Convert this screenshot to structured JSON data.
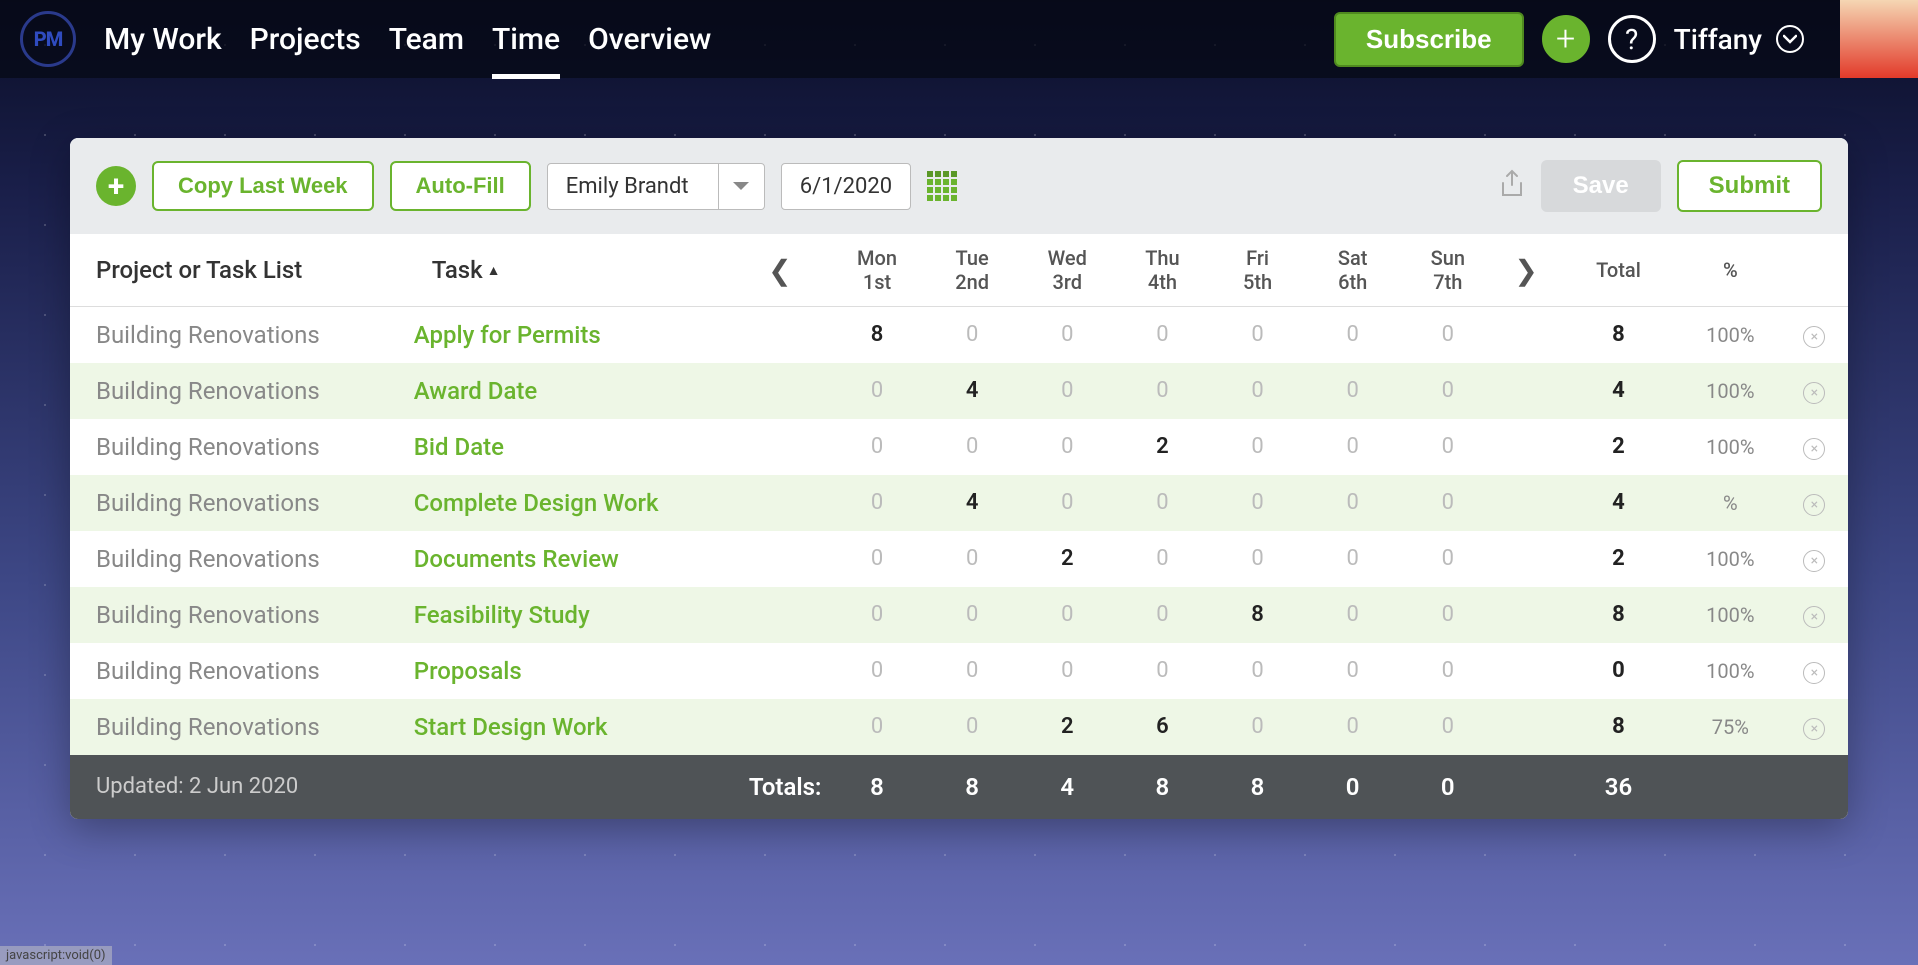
{
  "header": {
    "logo": "PM",
    "nav": [
      "My Work",
      "Projects",
      "Team",
      "Time",
      "Overview"
    ],
    "active_index": 3,
    "subscribe": "Subscribe",
    "user": "Tiffany"
  },
  "toolbar": {
    "copy_last_week": "Copy Last Week",
    "auto_fill": "Auto-Fill",
    "person": "Emily Brandt",
    "date": "6/1/2020",
    "save": "Save",
    "submit": "Submit"
  },
  "columns": {
    "project": "Project or Task List",
    "task": "Task",
    "total": "Total",
    "pct": "%",
    "days": [
      {
        "day": "Mon",
        "num": "1st"
      },
      {
        "day": "Tue",
        "num": "2nd"
      },
      {
        "day": "Wed",
        "num": "3rd"
      },
      {
        "day": "Thu",
        "num": "4th"
      },
      {
        "day": "Fri",
        "num": "5th"
      },
      {
        "day": "Sat",
        "num": "6th"
      },
      {
        "day": "Sun",
        "num": "7th"
      }
    ]
  },
  "rows": [
    {
      "project": "Building Renovations",
      "task": "Apply for Permits",
      "h": [
        8,
        0,
        0,
        0,
        0,
        0,
        0
      ],
      "total": 8,
      "pct": "100%"
    },
    {
      "project": "Building Renovations",
      "task": "Award Date",
      "h": [
        0,
        4,
        0,
        0,
        0,
        0,
        0
      ],
      "total": 4,
      "pct": "100%"
    },
    {
      "project": "Building Renovations",
      "task": "Bid Date",
      "h": [
        0,
        0,
        0,
        2,
        0,
        0,
        0
      ],
      "total": 2,
      "pct": "100%"
    },
    {
      "project": "Building Renovations",
      "task": "Complete Design Work",
      "h": [
        0,
        4,
        0,
        0,
        0,
        0,
        0
      ],
      "total": 4,
      "pct": "%"
    },
    {
      "project": "Building Renovations",
      "task": "Documents Review",
      "h": [
        0,
        0,
        2,
        0,
        0,
        0,
        0
      ],
      "total": 2,
      "pct": "100%"
    },
    {
      "project": "Building Renovations",
      "task": "Feasibility Study",
      "h": [
        0,
        0,
        0,
        0,
        8,
        0,
        0
      ],
      "total": 8,
      "pct": "100%"
    },
    {
      "project": "Building Renovations",
      "task": "Proposals",
      "h": [
        0,
        0,
        0,
        0,
        0,
        0,
        0
      ],
      "total": 0,
      "pct": "100%"
    },
    {
      "project": "Building Renovations",
      "task": "Start Design Work",
      "h": [
        0,
        0,
        2,
        6,
        0,
        0,
        0
      ],
      "total": 8,
      "pct": "75%"
    }
  ],
  "totals": {
    "label": "Totals:",
    "h": [
      8,
      8,
      4,
      8,
      8,
      0,
      0
    ],
    "grand": 36
  },
  "updated": "Updated: 2 Jun 2020",
  "status_bar": "javascript:void(0)"
}
